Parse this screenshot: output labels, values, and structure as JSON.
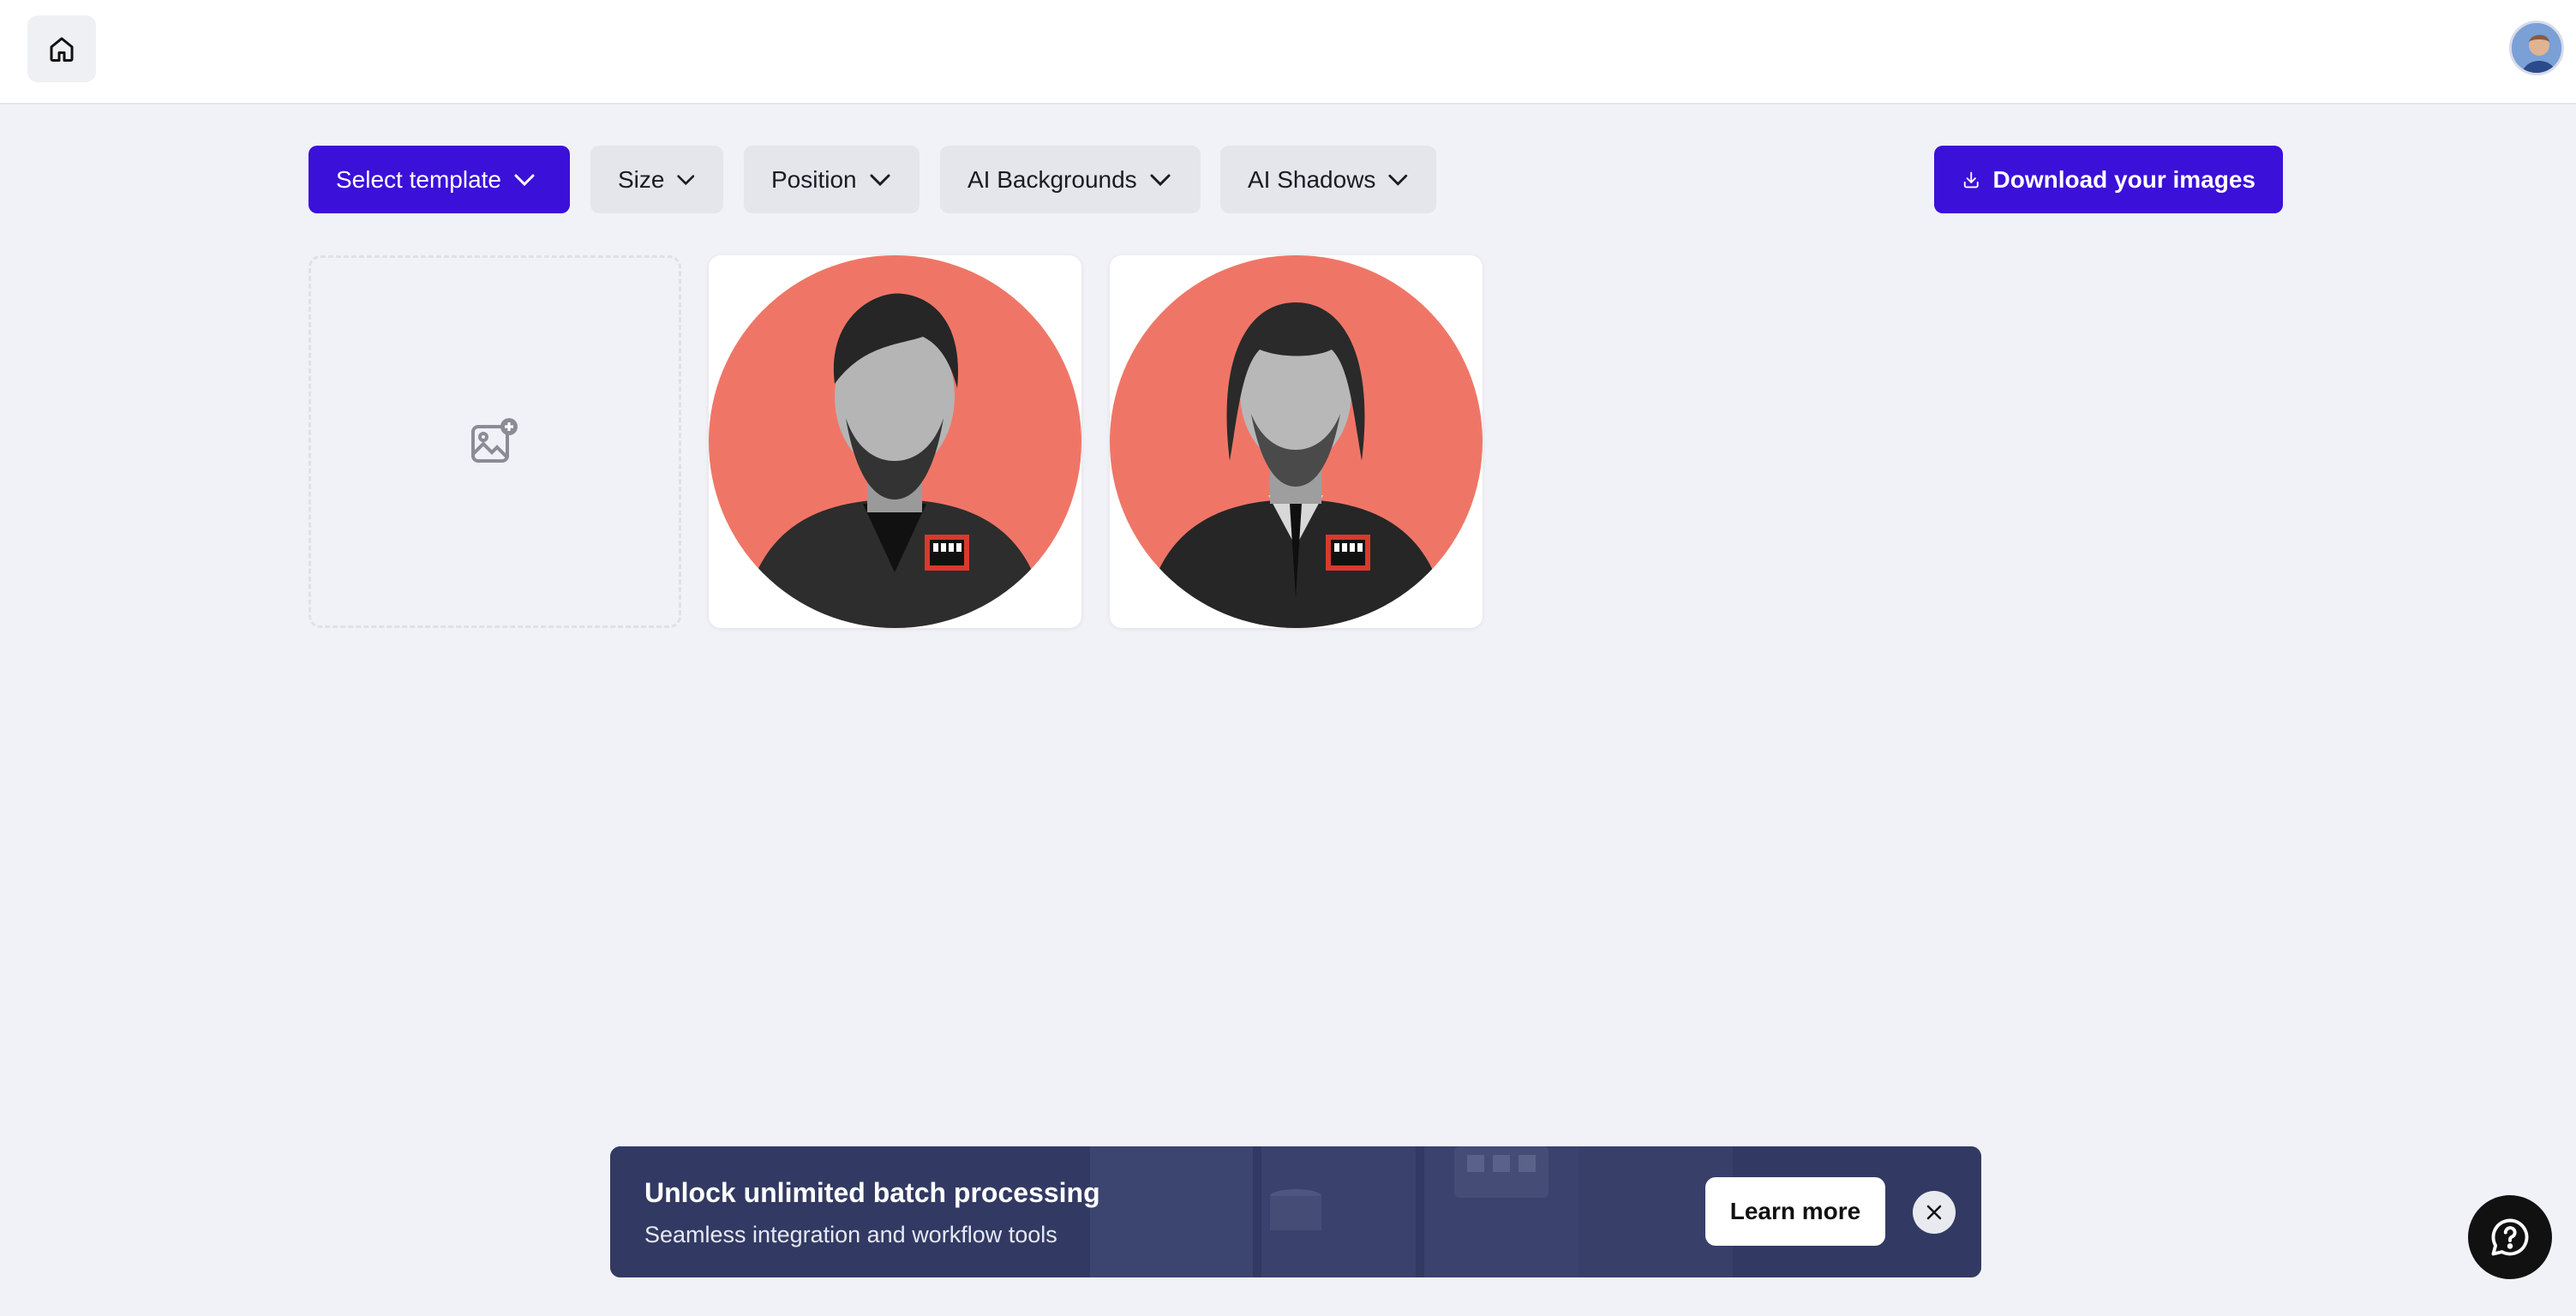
{
  "header": {
    "home_icon": "home-icon",
    "avatar_icon": "user-avatar"
  },
  "toolbar": {
    "select_template": "Select template",
    "size": "Size",
    "position": "Position",
    "ai_backgrounds": "AI Backgrounds",
    "ai_shadows": "AI Shadows",
    "download": "Download your images",
    "download_icon": "download-icon",
    "chevron_icon": "chevron-down-icon"
  },
  "grid": {
    "upload_icon": "add-image-icon",
    "images": [
      {
        "subject": "portrait-1"
      },
      {
        "subject": "portrait-2"
      }
    ]
  },
  "banner": {
    "title": "Unlock unlimited batch processing",
    "subtitle": "Seamless integration and workflow tools",
    "learn_more": "Learn more",
    "close_icon": "close-icon"
  },
  "help": {
    "icon": "help-chat-icon"
  },
  "colors": {
    "primary": "#3b10d9",
    "background": "#f1f2f7",
    "tile_circle": "#ef7667",
    "banner_bg": "#333a63"
  }
}
